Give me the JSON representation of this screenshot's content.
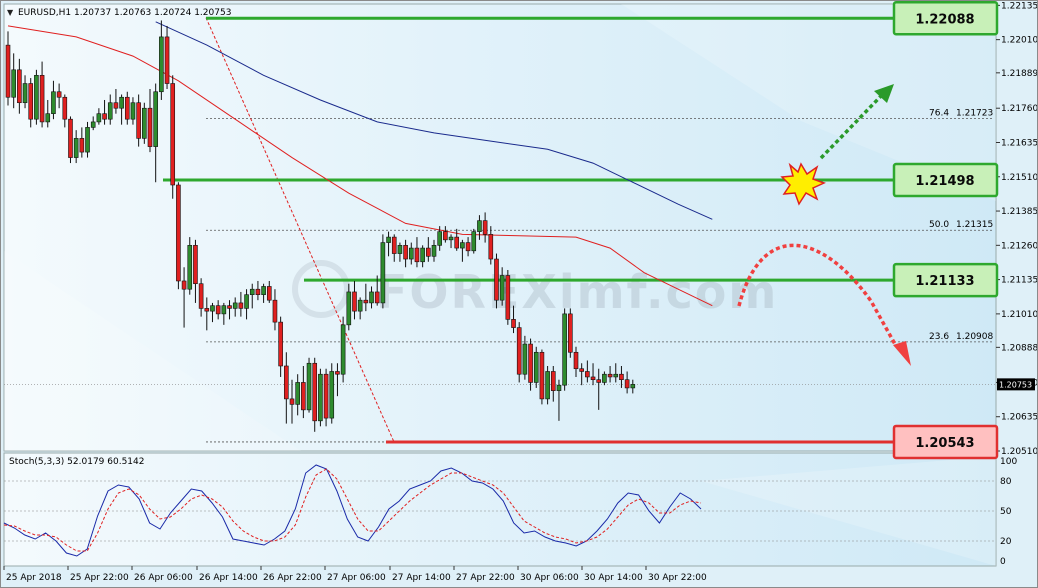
{
  "window": {
    "symbol": "EURUSD,H1",
    "ohlc": "1.20737 1.20763 1.20724 1.20753",
    "indicator_label": "Stoch(5,3,3) 52.0179 60.5142",
    "watermark": "FOREXimf.com"
  },
  "colors": {
    "bull_candle": "#2e8b2e",
    "bear_candle": "#e02020",
    "ma_fast": "#e02020",
    "ma_slow": "#1a2a8c",
    "level_green": "#2ea82e",
    "level_red": "#e03030",
    "label_green_bg": "#c8f0b8",
    "label_red_bg": "#ffc0c0",
    "stoch_main": "#1a2aa8",
    "stoch_signal": "#e02020"
  },
  "icons": [
    "explosion-icon",
    "green-up-arrow-icon",
    "red-down-curve-arrow-icon",
    "dropdown-triangle-icon"
  ],
  "chart_data": [
    {
      "type": "candlestick",
      "title": "EURUSD,H1 1.20737 1.20763 1.20724 1.20753",
      "ylim": [
        1.2051,
        1.2214
      ],
      "y_ticks": [
        "1.22135",
        "1.22010",
        "1.21889",
        "1.21760",
        "1.21635",
        "1.21510",
        "1.21385",
        "1.21260",
        "1.21135",
        "1.21010",
        "1.20888",
        "1.20760",
        "1.20635",
        "1.20510"
      ],
      "x_ticks": [
        "25 Apr 2018",
        "25 Apr 22:00",
        "26 Apr 06:00",
        "26 Apr 14:00",
        "26 Apr 22:00",
        "27 Apr 06:00",
        "27 Apr 14:00",
        "27 Apr 22:00",
        "30 Apr 06:00",
        "30 Apr 14:00",
        "30 Apr 22:00"
      ],
      "current_price": "1.20753",
      "levels": [
        {
          "label": "1.22088",
          "value": 1.22088,
          "kind": "resistance"
        },
        {
          "label": "1.21498",
          "value": 1.21498,
          "kind": "resistance"
        },
        {
          "label": "1.21133",
          "value": 1.21133,
          "kind": "resistance"
        },
        {
          "label": "1.20543",
          "value": 1.20543,
          "kind": "support"
        }
      ],
      "fibonacci": [
        {
          "ratio": "76.4",
          "price": "1.21723",
          "value": 1.21723
        },
        {
          "ratio": "50.0",
          "price": "1.21315",
          "value": 1.21315
        },
        {
          "ratio": "23.6",
          "price": "1.20908",
          "value": 1.20908
        }
      ],
      "moving_averages": [
        {
          "color": "red",
          "points": [
            [
              0,
              1.2206
            ],
            [
              12,
              1.2202
            ],
            [
              22,
              1.2195
            ],
            [
              30,
              1.2186
            ],
            [
              40,
              1.2172
            ],
            [
              50,
              1.2158
            ],
            [
              60,
              1.2145
            ],
            [
              70,
              1.2134
            ],
            [
              80,
              1.213
            ],
            [
              90,
              1.21295
            ],
            [
              100,
              1.2129
            ],
            [
              106,
              1.2125
            ],
            [
              112,
              1.2116
            ],
            [
              118,
              1.211
            ],
            [
              124,
              1.2104
            ]
          ]
        },
        {
          "color": "blue",
          "points": [
            [
              26,
              1.22075
            ],
            [
              35,
              1.2199
            ],
            [
              45,
              1.2188
            ],
            [
              55,
              1.2179
            ],
            [
              65,
              1.2171
            ],
            [
              75,
              1.2167
            ],
            [
              85,
              1.2164
            ],
            [
              95,
              1.2161
            ],
            [
              103,
              1.2156
            ],
            [
              110,
              1.2149
            ],
            [
              118,
              1.2141
            ],
            [
              124,
              1.21355
            ]
          ]
        }
      ],
      "candles": [
        [
          1.2199,
          1.2204,
          1.2177,
          1.218
        ],
        [
          1.218,
          1.2196,
          1.2176,
          1.219
        ],
        [
          1.219,
          1.2194,
          1.2174,
          1.2178
        ],
        [
          1.2178,
          1.2188,
          1.2176,
          1.2185
        ],
        [
          1.2185,
          1.2187,
          1.2169,
          1.2172
        ],
        [
          1.2172,
          1.219,
          1.217,
          1.2188
        ],
        [
          1.2188,
          1.2193,
          1.2169,
          1.2171
        ],
        [
          1.2171,
          1.2179,
          1.2169,
          1.2174
        ],
        [
          1.2174,
          1.2186,
          1.2172,
          1.2182
        ],
        [
          1.2182,
          1.2185,
          1.2176,
          1.218
        ],
        [
          1.218,
          1.2181,
          1.2169,
          1.2172
        ],
        [
          1.2172,
          1.2173,
          1.2156,
          1.2158
        ],
        [
          1.2158,
          1.2168,
          1.2156,
          1.2165
        ],
        [
          1.2165,
          1.2169,
          1.2158,
          1.216
        ],
        [
          1.216,
          1.2171,
          1.2158,
          1.2169
        ],
        [
          1.2169,
          1.2173,
          1.2168,
          1.2171
        ],
        [
          1.2171,
          1.2176,
          1.217,
          1.2174
        ],
        [
          1.2174,
          1.2179,
          1.217,
          1.2172
        ],
        [
          1.2172,
          1.2181,
          1.217,
          1.2178
        ],
        [
          1.2178,
          1.2183,
          1.2174,
          1.2176
        ],
        [
          1.2176,
          1.2181,
          1.217,
          1.218
        ],
        [
          1.218,
          1.2182,
          1.217,
          1.2172
        ],
        [
          1.2172,
          1.218,
          1.217,
          1.2178
        ],
        [
          1.2178,
          1.2181,
          1.2162,
          1.2165
        ],
        [
          1.2165,
          1.2178,
          1.2163,
          1.2176
        ],
        [
          1.2176,
          1.2183,
          1.216,
          1.2162
        ],
        [
          1.2162,
          1.2185,
          1.2149,
          1.2182
        ],
        [
          1.2182,
          1.2208,
          1.2179,
          1.2202
        ],
        [
          1.2202,
          1.2206,
          1.2183,
          1.2185
        ],
        [
          1.2185,
          1.2188,
          1.2143,
          1.2148
        ],
        [
          1.2148,
          1.2149,
          1.211,
          1.2113
        ],
        [
          1.2113,
          1.2118,
          1.2096,
          1.211
        ],
        [
          1.211,
          1.2129,
          1.2108,
          1.2126
        ],
        [
          1.2126,
          1.2128,
          1.2105,
          1.2112
        ],
        [
          1.2112,
          1.2114,
          1.21,
          1.2103
        ],
        [
          1.2103,
          1.2107,
          1.2095,
          1.2102
        ],
        [
          1.2102,
          1.2105,
          1.2098,
          1.2104
        ],
        [
          1.2104,
          1.2106,
          1.2099,
          1.2101
        ],
        [
          1.2101,
          1.2105,
          1.2097,
          1.2104
        ],
        [
          1.2104,
          1.2106,
          1.2099,
          1.2103
        ],
        [
          1.2103,
          1.2107,
          1.21,
          1.2105
        ],
        [
          1.2105,
          1.2109,
          1.21,
          1.2103
        ],
        [
          1.2103,
          1.211,
          1.2099,
          1.2108
        ],
        [
          1.2108,
          1.2112,
          1.2103,
          1.211
        ],
        [
          1.211,
          1.2113,
          1.2106,
          1.2108
        ],
        [
          1.2108,
          1.2112,
          1.2105,
          1.2111
        ],
        [
          1.2111,
          1.2113,
          1.2105,
          1.2106
        ],
        [
          1.2106,
          1.211,
          1.2095,
          1.2098
        ],
        [
          1.2098,
          1.21,
          1.2078,
          1.2082
        ],
        [
          1.2082,
          1.2087,
          1.2061,
          1.207
        ],
        [
          1.207,
          1.2077,
          1.2061,
          1.2068
        ],
        [
          1.2068,
          1.2079,
          1.2064,
          1.2076
        ],
        [
          1.2076,
          1.2082,
          1.2063,
          1.2066
        ],
        [
          1.2066,
          1.2085,
          1.2065,
          1.2083
        ],
        [
          1.2083,
          1.2085,
          1.2058,
          1.2062
        ],
        [
          1.2062,
          1.2081,
          1.206,
          1.2079
        ],
        [
          1.2079,
          1.2081,
          1.206,
          1.2063
        ],
        [
          1.2063,
          1.2083,
          1.2061,
          1.208
        ],
        [
          1.208,
          1.2083,
          1.2071,
          1.2079
        ],
        [
          1.2079,
          1.21,
          1.2076,
          1.2097
        ],
        [
          1.2097,
          1.2112,
          1.2095,
          1.2109
        ],
        [
          1.2109,
          1.2113,
          1.2099,
          1.2102
        ],
        [
          1.2102,
          1.2107,
          1.2099,
          1.2106
        ],
        [
          1.2106,
          1.2112,
          1.2102,
          1.2105
        ],
        [
          1.2105,
          1.2111,
          1.2103,
          1.2109
        ],
        [
          1.2109,
          1.2115,
          1.2104,
          1.2105
        ],
        [
          1.2105,
          1.213,
          1.2103,
          1.2127
        ],
        [
          1.2127,
          1.2131,
          1.2122,
          1.2129
        ],
        [
          1.2129,
          1.213,
          1.212,
          1.2123
        ],
        [
          1.2123,
          1.2127,
          1.212,
          1.2126
        ],
        [
          1.2126,
          1.2128,
          1.2118,
          1.2121
        ],
        [
          1.2121,
          1.2127,
          1.2119,
          1.2125
        ],
        [
          1.2125,
          1.2129,
          1.2118,
          1.212
        ],
        [
          1.212,
          1.2126,
          1.2118,
          1.2125
        ],
        [
          1.2125,
          1.2129,
          1.212,
          1.2122
        ],
        [
          1.2122,
          1.2128,
          1.212,
          1.2126
        ],
        [
          1.2126,
          1.2133,
          1.2124,
          1.2131
        ],
        [
          1.2131,
          1.2133,
          1.2127,
          1.2128
        ],
        [
          1.2128,
          1.213,
          1.2125,
          1.2129
        ],
        [
          1.2129,
          1.2132,
          1.2124,
          1.2125
        ],
        [
          1.2125,
          1.2128,
          1.212,
          1.2127
        ],
        [
          1.2127,
          1.2129,
          1.2122,
          1.2124
        ],
        [
          1.2124,
          1.2132,
          1.2123,
          1.2131
        ],
        [
          1.2131,
          1.2137,
          1.2128,
          1.2135
        ],
        [
          1.2135,
          1.2138,
          1.2127,
          1.213
        ],
        [
          1.213,
          1.2133,
          1.2119,
          1.2121
        ],
        [
          1.2121,
          1.2123,
          1.2103,
          1.2106
        ],
        [
          1.2106,
          1.2118,
          1.2104,
          1.2115
        ],
        [
          1.2115,
          1.2117,
          1.2097,
          1.2099
        ],
        [
          1.2099,
          1.2104,
          1.2094,
          1.2096
        ],
        [
          1.2096,
          1.2098,
          1.2076,
          1.2079
        ],
        [
          1.2079,
          1.2093,
          1.2077,
          1.209
        ],
        [
          1.209,
          1.2092,
          1.2073,
          1.2076
        ],
        [
          1.2076,
          1.2089,
          1.2074,
          1.2087
        ],
        [
          1.2087,
          1.2088,
          1.2068,
          1.207
        ],
        [
          1.207,
          1.2082,
          1.2068,
          1.208
        ],
        [
          1.208,
          1.2082,
          1.2069,
          1.2073
        ],
        [
          1.2073,
          1.2077,
          1.2062,
          1.2075
        ],
        [
          1.2075,
          1.2103,
          1.2073,
          1.2101
        ],
        [
          1.2101,
          1.2103,
          1.2085,
          1.2087
        ],
        [
          1.2087,
          1.2089,
          1.2078,
          1.2081
        ],
        [
          1.2081,
          1.2083,
          1.2075,
          1.208
        ],
        [
          1.208,
          1.2084,
          1.2076,
          1.2078
        ],
        [
          1.2078,
          1.2083,
          1.2075,
          1.2077
        ],
        [
          1.2077,
          1.2081,
          1.2066,
          1.2076
        ],
        [
          1.2076,
          1.208,
          1.2075,
          1.2079
        ],
        [
          1.2079,
          1.2082,
          1.2076,
          1.2078
        ],
        [
          1.2078,
          1.2083,
          1.2076,
          1.2079
        ],
        [
          1.2079,
          1.2082,
          1.2074,
          1.2077
        ],
        [
          1.2077,
          1.208,
          1.2072,
          1.2074
        ],
        [
          1.2074,
          1.2077,
          1.2072,
          1.20753
        ]
      ]
    },
    {
      "type": "line",
      "title": "Stoch(5,3,3) 52.0179 60.5142",
      "ylim": [
        0,
        100
      ],
      "y_ticks": [
        "100",
        "80",
        "50",
        "20",
        "0"
      ],
      "series": [
        {
          "values": [
            38,
            33,
            26,
            22,
            28,
            20,
            8,
            5,
            12,
            45,
            70,
            76,
            74,
            62,
            38,
            32,
            48,
            60,
            72,
            70,
            58,
            44,
            22,
            20,
            18,
            16,
            22,
            30,
            52,
            88,
            96,
            92,
            70,
            42,
            24,
            20,
            34,
            52,
            60,
            72,
            76,
            80,
            90,
            93,
            88,
            80,
            78,
            72,
            60,
            38,
            28,
            30,
            24,
            20,
            18,
            15,
            20,
            30,
            42,
            58,
            68,
            66,
            50,
            38,
            54,
            68,
            62,
            52
          ]
        },
        {
          "values": [
            36,
            35,
            30,
            26,
            26,
            24,
            16,
            10,
            10,
            28,
            52,
            68,
            72,
            66,
            52,
            42,
            44,
            52,
            62,
            66,
            62,
            54,
            40,
            30,
            24,
            20,
            20,
            24,
            36,
            64,
            86,
            92,
            82,
            62,
            42,
            30,
            30,
            40,
            50,
            60,
            68,
            76,
            82,
            88,
            88,
            84,
            80,
            76,
            68,
            54,
            40,
            34,
            28,
            24,
            22,
            18,
            20,
            24,
            32,
            44,
            56,
            62,
            58,
            48,
            48,
            56,
            60,
            58
          ]
        }
      ]
    }
  ]
}
